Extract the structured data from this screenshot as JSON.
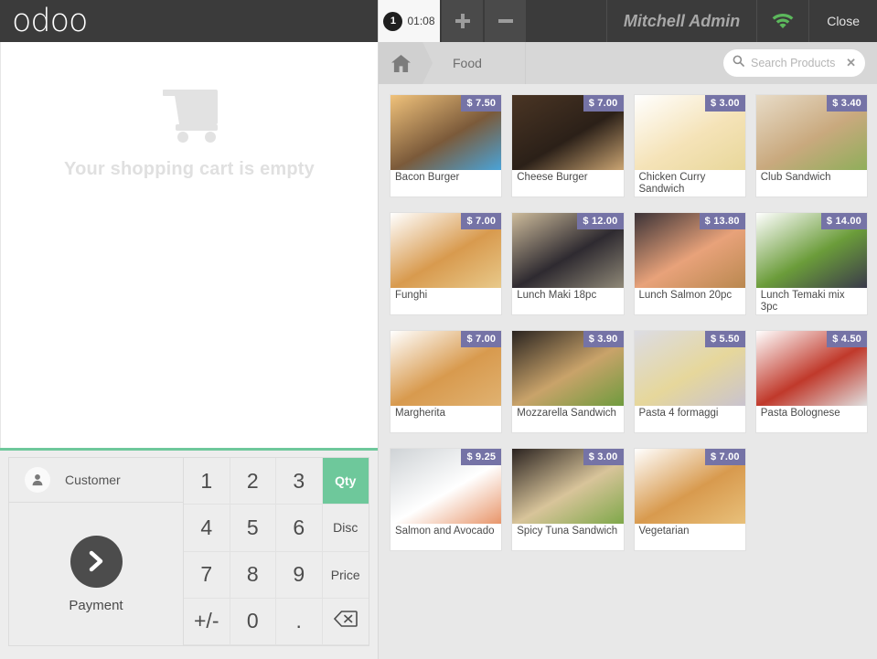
{
  "brand": {
    "logo_text": "odoo"
  },
  "cart": {
    "empty_message": "Your shopping cart is empty",
    "icon": "shopping-cart-icon"
  },
  "actionpad": {
    "customer_label": "Customer",
    "customer_icon": "user-icon",
    "payment_label": "Payment",
    "payment_icon": "chevron-right-icon"
  },
  "numpad": {
    "keys": [
      {
        "label": "1",
        "type": "digit"
      },
      {
        "label": "2",
        "type": "digit"
      },
      {
        "label": "3",
        "type": "digit"
      },
      {
        "label": "Qty",
        "type": "mode-active"
      },
      {
        "label": "4",
        "type": "digit"
      },
      {
        "label": "5",
        "type": "digit"
      },
      {
        "label": "6",
        "type": "digit"
      },
      {
        "label": "Disc",
        "type": "mode"
      },
      {
        "label": "7",
        "type": "digit"
      },
      {
        "label": "8",
        "type": "digit"
      },
      {
        "label": "9",
        "type": "digit"
      },
      {
        "label": "Price",
        "type": "mode"
      },
      {
        "label": "+/-",
        "type": "sign"
      },
      {
        "label": "0",
        "type": "digit"
      },
      {
        "label": ".",
        "type": "digit"
      },
      {
        "label": "backspace-icon",
        "type": "backspace"
      }
    ],
    "active_mode": "Qty",
    "active_color": "#6ec89b"
  },
  "topbar": {
    "order_tab": {
      "number": "1",
      "timer": "01:08"
    },
    "add_order_label": "+",
    "remove_order_label": "–",
    "username": "Mitchell Admin",
    "wifi_icon": "wifi-icon",
    "wifi_color": "#5cb85c",
    "close_label": "Close"
  },
  "breadcrumb": {
    "home_icon": "home-icon",
    "category": "Food"
  },
  "search": {
    "icon": "search-icon",
    "placeholder": "Search Products",
    "value": "",
    "clear_icon": "close-icon"
  },
  "products": [
    {
      "name": "Bacon Burger",
      "price": "$ 7.50",
      "c1": "#f0c27b",
      "c2": "#7b5a3a",
      "c3": "#4aa3d8"
    },
    {
      "name": "Cheese Burger",
      "price": "$ 7.00",
      "c1": "#4a3524",
      "c2": "#2b2018",
      "c3": "#caa472"
    },
    {
      "name": "Chicken Curry Sandwich",
      "price": "$ 3.00",
      "c1": "#ffffff",
      "c2": "#f5e3b8",
      "c3": "#e8d79a"
    },
    {
      "name": "Club Sandwich",
      "price": "$ 3.40",
      "c1": "#e8dcc8",
      "c2": "#c9a97e",
      "c3": "#8fae5a"
    },
    {
      "name": "Funghi",
      "price": "$ 7.00",
      "c1": "#ffffff",
      "c2": "#d89a4e",
      "c3": "#e8c98a"
    },
    {
      "name": "Lunch Maki 18pc",
      "price": "$ 12.00",
      "c1": "#cdbb9b",
      "c2": "#2e2a30",
      "c3": "#8f8877"
    },
    {
      "name": "Lunch Salmon 20pc",
      "price": "$ 13.80",
      "c1": "#3b3236",
      "c2": "#e8a27a",
      "c3": "#b9884f"
    },
    {
      "name": "Lunch Temaki mix 3pc",
      "price": "$ 14.00",
      "c1": "#ffffff",
      "c2": "#6b9c3a",
      "c3": "#3a3a4a"
    },
    {
      "name": "Margherita",
      "price": "$ 7.00",
      "c1": "#ffffff",
      "c2": "#d89a4e",
      "c3": "#e0b271"
    },
    {
      "name": "Mozzarella Sandwich",
      "price": "$ 3.90",
      "c1": "#2a2420",
      "c2": "#c9a36a",
      "c3": "#6f9b3e"
    },
    {
      "name": "Pasta 4 formaggi",
      "price": "$ 5.50",
      "c1": "#dcdce4",
      "c2": "#e6d79b",
      "c3": "#c9c3cf"
    },
    {
      "name": "Pasta Bolognese",
      "price": "$ 4.50",
      "c1": "#ffffff",
      "c2": "#c0392b",
      "c3": "#e0e0e0"
    },
    {
      "name": "Salmon and Avocado",
      "price": "$ 9.25",
      "c1": "#cfd3d6",
      "c2": "#ffffff",
      "c3": "#e8956a"
    },
    {
      "name": "Spicy Tuna Sandwich",
      "price": "$ 3.00",
      "c1": "#2b2320",
      "c2": "#d8c49a",
      "c3": "#7fa84a"
    },
    {
      "name": "Vegetarian",
      "price": "$ 7.00",
      "c1": "#ffffff",
      "c2": "#d89a4e",
      "c3": "#e8c07a"
    }
  ]
}
